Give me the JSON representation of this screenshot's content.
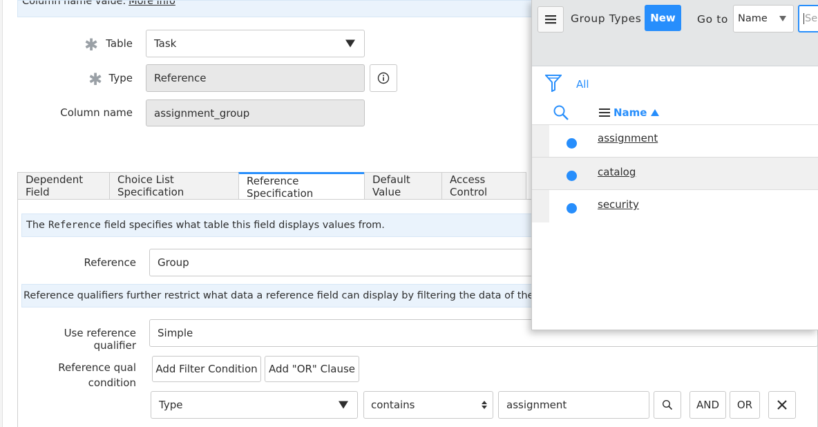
{
  "top_info": {
    "text": "Column name value.",
    "link": "More info"
  },
  "form": {
    "table": {
      "label": "Table",
      "value": "Task"
    },
    "type": {
      "label": "Type",
      "value": "Reference"
    },
    "column_name": {
      "label": "Column name",
      "value": "assignment_group"
    }
  },
  "tabs": [
    "Dependent Field",
    "Choice List Specification",
    "Reference Specification",
    "Default Value",
    "Access Control"
  ],
  "active_tab": "Reference Specification",
  "ref_spec": {
    "info1_pre": "The",
    "info1_code": "Reference",
    "info1_post": "field specifies what table this field displays values from.",
    "reference_label": "Reference",
    "reference_value": "Group",
    "info2": "Reference qualifiers further restrict what data a reference field can display by filtering the data of the reference",
    "use_qual_label": "Use reference qualifier",
    "use_qual_value": "Simple",
    "qual_label_1": "Reference qual",
    "qual_label_2": "condition",
    "add_filter": "Add Filter Condition",
    "add_or": "Add \"OR\" Clause",
    "cond_field": "Type",
    "cond_op": "contains",
    "cond_value": "assignment",
    "and_btn": "AND",
    "or_btn": "OR"
  },
  "popup": {
    "title": "Group Types",
    "new_btn": "New",
    "goto_label": "Go to",
    "goto_select": "Name",
    "search_placeholder": "Se",
    "filter_all": "All",
    "column_header": "Name",
    "rows": [
      "assignment",
      "catalog",
      "security"
    ]
  },
  "colors": {
    "accent": "#278efc",
    "info_band": "#eaf3fc",
    "readonly": "#e8e8e8"
  }
}
